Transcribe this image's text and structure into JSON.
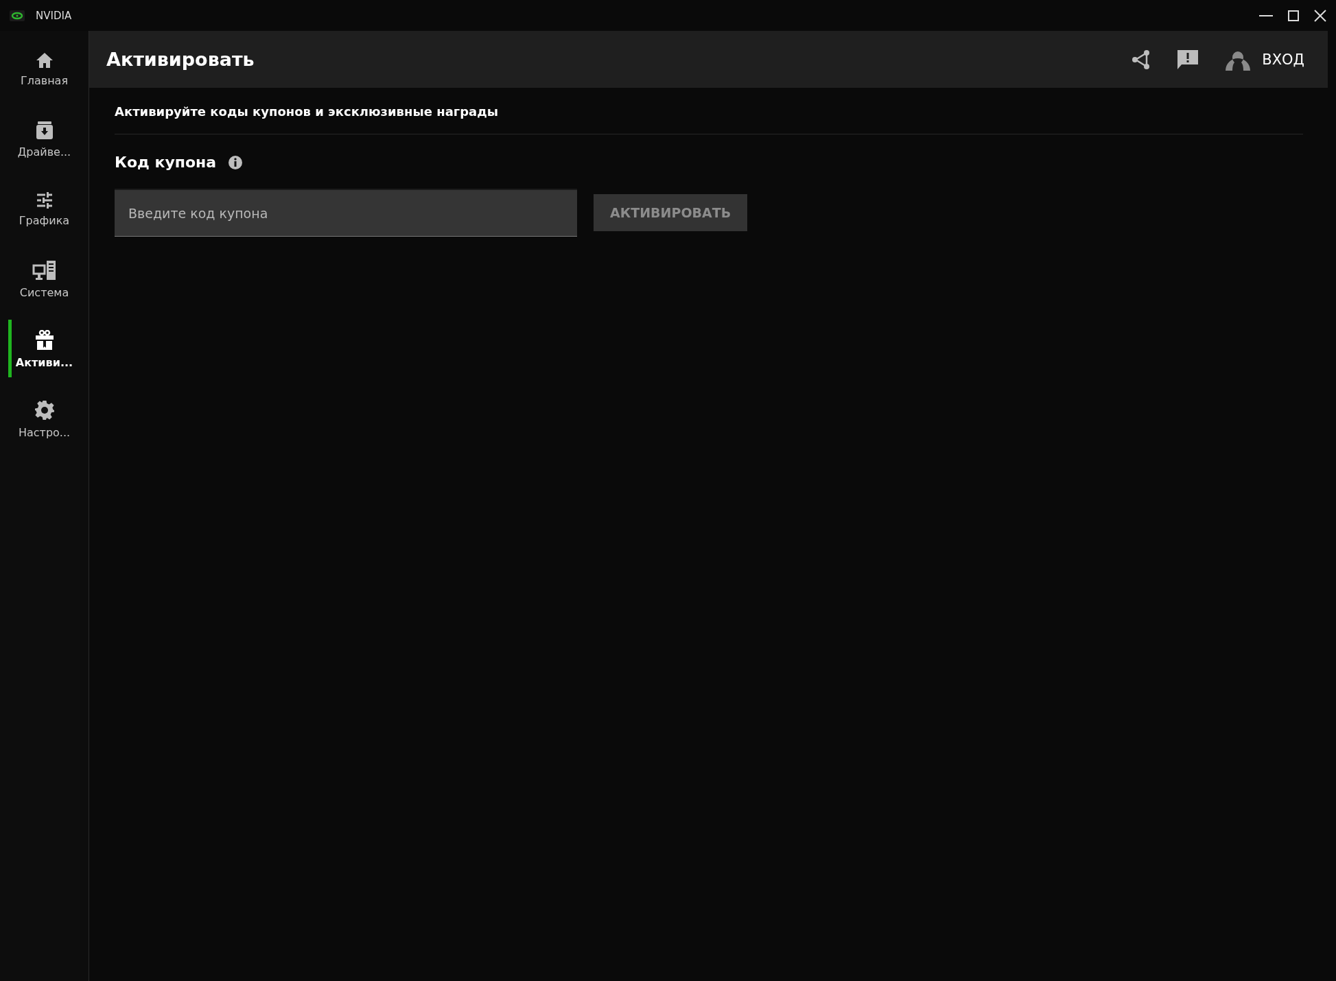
{
  "window": {
    "title": "NVIDIA"
  },
  "sidebar": {
    "items": [
      {
        "label": "Главная",
        "selected": false
      },
      {
        "label": "Драйве...",
        "selected": false
      },
      {
        "label": "Графика",
        "selected": false
      },
      {
        "label": "Система",
        "selected": false
      },
      {
        "label": "Активи...",
        "selected": true
      },
      {
        "label": "Настро...",
        "selected": false
      }
    ]
  },
  "header": {
    "title": "Активировать",
    "login": "ВХОД"
  },
  "content": {
    "subtitle": "Активируйте коды купонов и эксклюзивные награды",
    "field_label": "Код купона",
    "coupon_field": {
      "placeholder": "Введите код купона"
    },
    "activate_button": {
      "label": "АКТИВИРОВАТЬ",
      "disabled": true
    }
  }
}
